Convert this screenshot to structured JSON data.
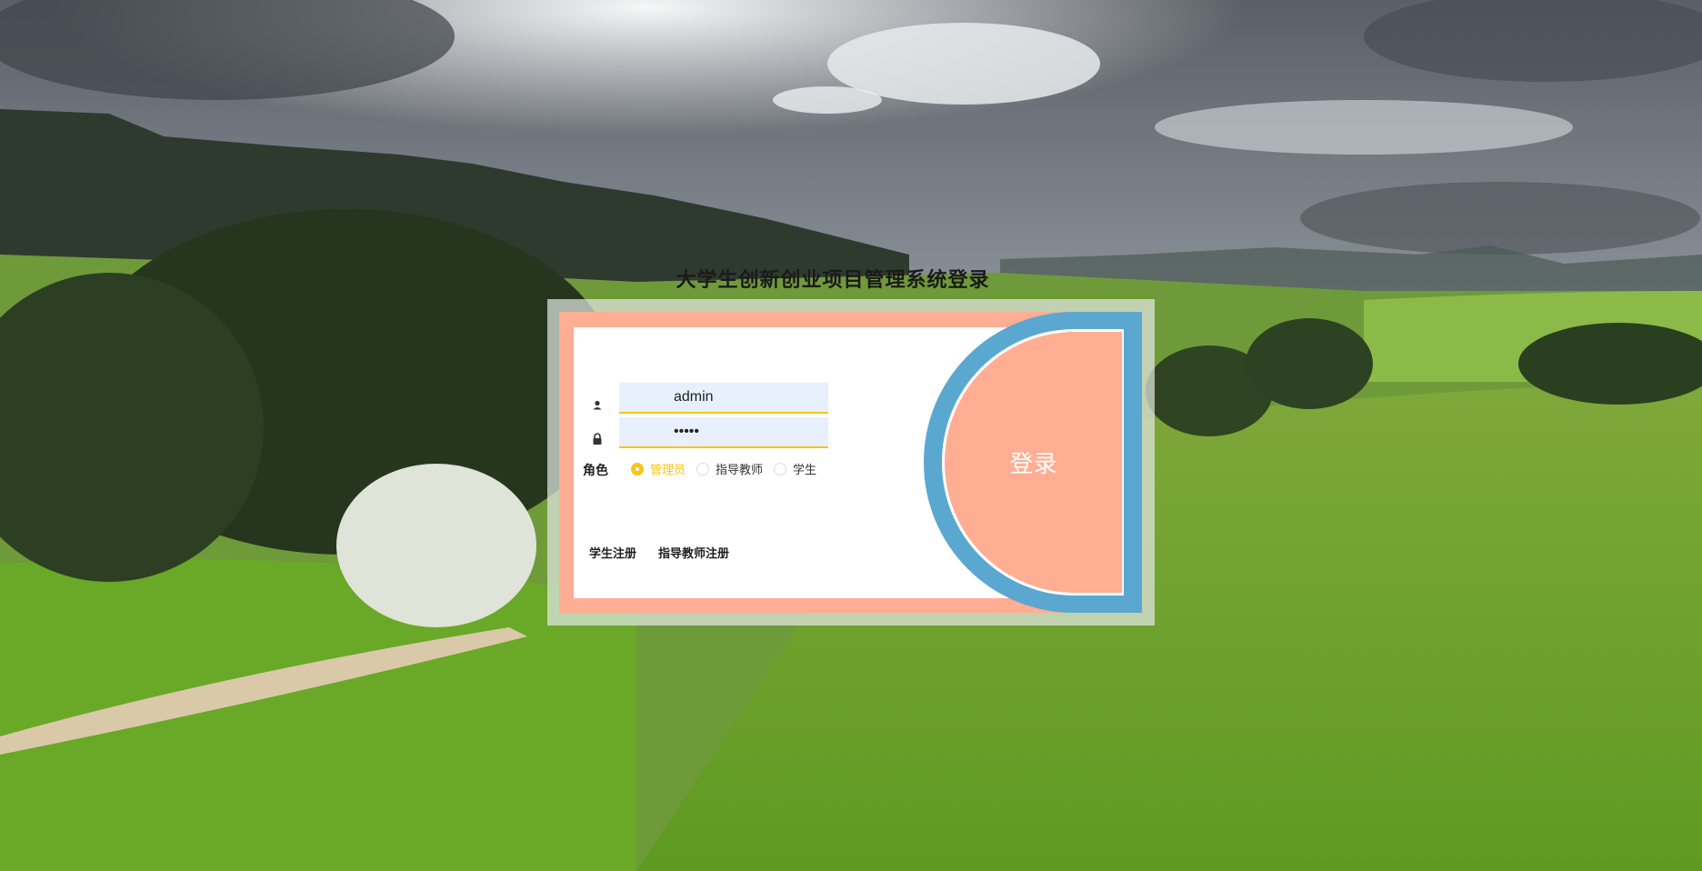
{
  "page": {
    "title": "大学生创新创业项目管理系统登录"
  },
  "form": {
    "username_value": "admin",
    "password_value": "•••••",
    "role_label": "角色",
    "roles": [
      "管理员",
      "指导教师",
      "学生"
    ],
    "selected_role": "管理员",
    "login_label": "登录",
    "student_register_label": "学生注册",
    "teacher_register_label": "指导教师注册"
  },
  "icons": {
    "username": "user-icon",
    "password": "lock-icon"
  },
  "colors": {
    "card_accent": "#ffad93",
    "login_ring": "#5aa8d0",
    "input_bg": "#e8f0fe",
    "input_underline": "#f5c518",
    "selected_radio": "#f5c518"
  }
}
